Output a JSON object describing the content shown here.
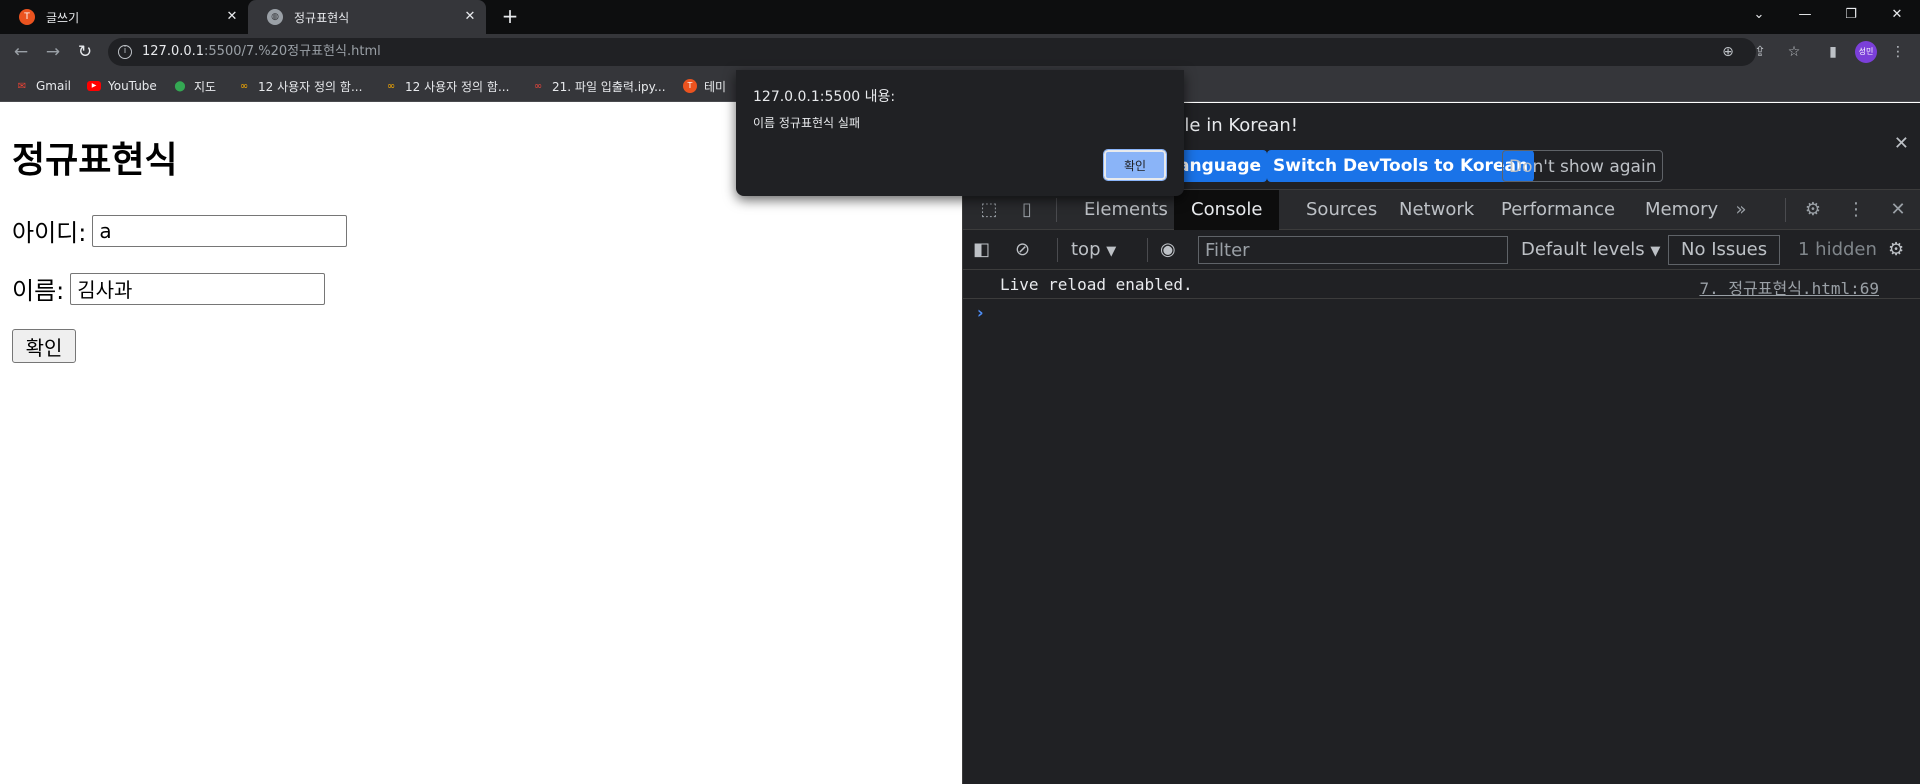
{
  "browser": {
    "tabs": [
      {
        "title": "글쓰기",
        "favicon": "tistory-icon"
      },
      {
        "title": "정규표현식",
        "favicon": "globe-icon"
      }
    ],
    "url_host": "127.0.0.1",
    "url_path": ":5500/7.%20정규표현식.html",
    "profile_initials": "성민",
    "bookmarks": [
      {
        "label": "Gmail",
        "icon": "gmail-icon"
      },
      {
        "label": "YouTube",
        "icon": "youtube-icon"
      },
      {
        "label": "지도",
        "icon": "maps-icon"
      },
      {
        "label": "12 사용자 정의 함...",
        "icon": "colab-icon"
      },
      {
        "label": "12 사용자 정의 함...",
        "icon": "colab-icon"
      },
      {
        "label": "21. 파일 입출력.ipy...",
        "icon": "colab-icon"
      },
      {
        "label": "테미",
        "icon": "tistory-icon"
      }
    ]
  },
  "page": {
    "title": "정규표현식",
    "id_label": "아이디:",
    "id_value": "a",
    "name_label": "이름:",
    "name_value": "김사과",
    "submit_label": "확인"
  },
  "alert": {
    "origin": "127.0.0.1:5500 내용:",
    "message": "이름 정규표현식 실패",
    "ok_label": "확인"
  },
  "devtools": {
    "infobar_message": "ble in Korean!",
    "buttons": {
      "partial_language": "anguage",
      "switch_korean": "Switch DevTools to Korean",
      "dont_show": "Don't show again"
    },
    "tabs": [
      "Elements",
      "Console",
      "Sources",
      "Network",
      "Performance",
      "Memory"
    ],
    "active_tab": "Console",
    "console_toolbar": {
      "context": "top",
      "filter_placeholder": "Filter",
      "levels": "Default levels",
      "issues": "No Issues",
      "hidden": "1 hidden"
    },
    "messages": [
      {
        "text": "Live reload enabled.",
        "source": "7. 정규표현식.html:69"
      }
    ]
  },
  "colors": {
    "accent": "#8ab4f8",
    "devtools_button": "#1a73e8",
    "tab_strip": "#0d0e0f",
    "toolbar": "#35363a"
  }
}
